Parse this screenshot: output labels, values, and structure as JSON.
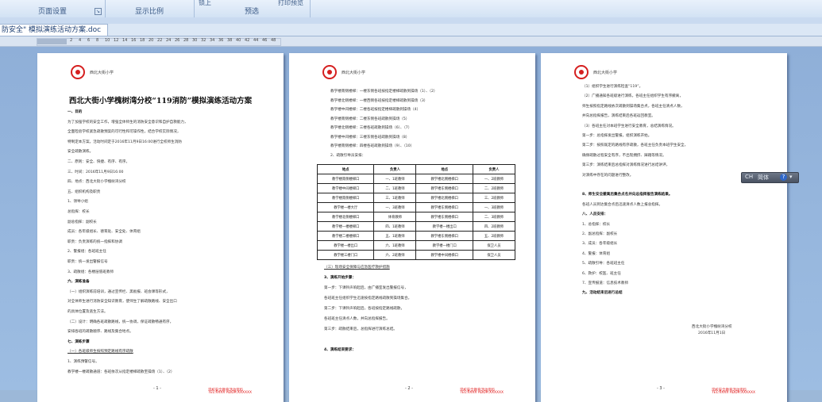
{
  "ribbon": {
    "groups": [
      "页面设置",
      "显示比例",
      "预选"
    ],
    "cut_labels": [
      "锁上",
      "打印预览"
    ]
  },
  "document_tab": {
    "title": "防安全\" 模拟演练活动方案.doc"
  },
  "ruler": {
    "ticks": [
      "2",
      "4",
      "6",
      "8",
      "10",
      "12",
      "14",
      "16",
      "18",
      "20",
      "22",
      "24",
      "26",
      "28",
      "30",
      "32",
      "34",
      "36",
      "38",
      "40",
      "42",
      "44",
      "46",
      "48"
    ]
  },
  "pages": [
    {
      "header": "西北大街小学",
      "title": "西北大街小学槐树湾分校“119消防”模拟演练活动方案",
      "lines": [
        {
          "t": "一、目的",
          "s": "b"
        },
        {
          "t": "为了加强学校的安全工作，增强全体师生的消防安全意识和自护自救能力，"
        },
        {
          "t": "全面检验学校紧急疏散预案的可行性和可操作性，结合学校实际情况，"
        },
        {
          "t": "特制定本方案。活动时间定于2016年11月9日16:00进行全校师生消防"
        },
        {
          "t": "安全疏散演练。"
        },
        {
          "t": "二、原则：安全、快捷、有序、有序。"
        },
        {
          "t": "三、时间：2016年11月9日16:00"
        },
        {
          "t": "四、地点：西北大街小学槐树湾分校"
        },
        {
          "t": "五、组织机构及职责"
        },
        {
          "t": "1、领导小组"
        },
        {
          "t": "总指挥：校长"
        },
        {
          "t": "副总指挥：副校长"
        },
        {
          "t": "成员：各年级组长、德育处、安全处、体育组"
        },
        {
          "t": "职责：负责演练的统一指挥和协调"
        },
        {
          "t": "2、警报组：各班班主任"
        },
        {
          "t": "职责：统一发出警报信号"
        },
        {
          "t": "3、疏散组：各楼层值班教师"
        },
        {
          "t": "六、演练准备",
          "s": "b"
        },
        {
          "t": "（一）组织演练前培训，通过宣传栏、黑板报、班会课等形式，"
        },
        {
          "t": "对全体师生进行消防安全知识教育，使师生了解疏散路线、安全出口"
        },
        {
          "t": "的具体位置及逃生方法。"
        },
        {
          "t": "（二）设计：明确各班疏散路线，统一协调，保证疏散畅通有序，"
        },
        {
          "t": "安排各班的疏散顺序、路线及集合地点。"
        },
        {
          "t": "七、演练步骤",
          "s": "b"
        },
        {
          "t": "（一）各班级师生按照预定路线有序疏散",
          "s": "u"
        },
        {
          "t": "1、演练预警信号。"
        },
        {
          "t": "教学楼一楼疏散通道：各班依次从指定楼梯疏散至操场（1）、（2）"
        }
      ],
      "page_num": "- 1 -",
      "red_footer": [
        "学校安全教育活动资料",
        "TEL:XXXX ADDR:XXXXXX"
      ]
    },
    {
      "header": "西北大街小学",
      "lines_top": [
        "教学楼南侧楼梯：一楼东侧各班按指定楼梯疏散到操场（1）、（2）",
        "教学楼北侧楼梯：一楼西侧各班按指定楼梯疏散到操场（3）",
        "教学楼中间楼梯：二楼各班按指定楼梯疏散到操场（4）",
        "教学楼南侧楼梯：二楼东侧各班疏散到操场（5）",
        "教学楼北侧楼梯：三楼各班疏散到操场（6）、（7）",
        "教学楼中间楼梯：三楼东侧各班疏散到操场（8）",
        "教学楼南侧楼梯：四楼各班疏散到操场（9）、（10）",
        "2、疏散引导员安排："
      ],
      "table": {
        "headers": [
          "地点",
          "负责人",
          "地点",
          "负责人"
        ],
        "rows": [
          [
            "教学楼南侧楼梯口",
            "一、1班教师",
            "教学楼北侧楼梯口",
            "一、2班教师"
          ],
          [
            "教学楼中间楼梯口",
            "二、1班教师",
            "教学楼东侧楼梯口",
            "二、2班教师"
          ],
          [
            "教学楼南侧楼梯口",
            "三、1班教师",
            "教学楼北侧楼梯口",
            "三、2班教师"
          ],
          [
            "教学楼一楼大厅",
            "一、3班教师",
            "教学楼东侧楼梯口",
            "一、3班教师"
          ],
          [
            "教学楼北侧楼梯口",
            "体育教师",
            "教学楼东侧楼梯口",
            "二、3班教师"
          ],
          [
            "教学楼一楼楼梯口",
            "四、1班教师",
            "教学楼一楼出口",
            "四、2班教师"
          ],
          [
            "教学楼二楼楼梯口",
            "五、1班教师",
            "教学楼东侧楼梯口",
            "五、2班教师"
          ],
          [
            "教学楼一楼出口",
            "六、1班教师",
            "教学楼一楼门口",
            "保卫人员"
          ],
          [
            "教学楼三楼门口",
            "六、2班教师",
            "教学楼中间楼梯口",
            "保卫人员"
          ]
        ]
      },
      "lines_bottom": [
        {
          "t": "（三）现场安全保障与应急医疗救护措施",
          "s": "u"
        },
        {
          "t": "3、演练开始步骤：",
          "s": "b"
        },
        {
          "t": "第一步：下课铃声响起后，由广播室发出警报信号，"
        },
        {
          "t": "各班班主任组织学生迅速按指定路线疏散到操场集合。"
        },
        {
          "t": "第二步：下课铃声响起后，各班按指定路线疏散，"
        },
        {
          "t": "各班班主任清点人数，并向总指挥报告。"
        },
        {
          "t": "第三步：疏散结束后，总指挥进行演练总结。"
        },
        {
          "t": ""
        },
        {
          "t": "4、演练结束要求：",
          "s": "b"
        }
      ],
      "page_num": "- 2 -",
      "red_footer": [
        "学校安全教育活动资料",
        "TEL:XXXX ADDR:XXXXXX"
      ]
    },
    {
      "header": "西北大街小学",
      "lines": [
        {
          "t": "（1）组织学生进行演练检查“119”。"
        },
        {
          "t": "（2）广播通知各班级进行演练，各班主任组织学生有序撤离，"
        },
        {
          "t": "师生按照指定路线依次疏散到操场集合点，各班主任清点人数，"
        },
        {
          "t": "并向总指挥报告，演练结束后各班返回教室。"
        },
        {
          "t": "（3）各班主任对本班学生进行安全教育，总结演练情况。"
        },
        {
          "t": "第一步：总指挥发出警报，组织演练开始。"
        },
        {
          "t": "第二步：按照既定的路线有序疏散，各班主任负责本班学生安全，"
        },
        {
          "t": "确保疏散过程安全有序，不出现拥挤、踩踏等情况。"
        },
        {
          "t": "第三步：演练结束后总指挥对演练情况进行总结讲评，"
        },
        {
          "t": "对演练中存在的问题进行整改。"
        },
        {
          "t": ""
        },
        {
          "t": "8、师生安全撤离后集合点名并向总指挥报告演练结果。",
          "s": "b"
        },
        {
          "t": "各班人员到达集合点后迅速清点人数上报总指挥。"
        },
        {
          "t": "八、人员安排：",
          "s": "b"
        },
        {
          "t": "1、总指挥：校长"
        },
        {
          "t": "2、副总指挥：副校长"
        },
        {
          "t": "3、成员：各年级组长"
        },
        {
          "t": "4、警报：体育组"
        },
        {
          "t": "5、疏散引导：各班班主任"
        },
        {
          "t": "6、救护：校医、班主任"
        },
        {
          "t": "7、宣传报道：信息技术教师"
        },
        {
          "t": "九、活动结束后进行总结",
          "s": "b"
        }
      ],
      "signature": "西北大街小学槐树湾分校",
      "date": "2016年11月1日",
      "page_num": "- 3 -",
      "red_footer": [
        "学校安全教育活动资料",
        "TEL:XXXX ADDR:XXXXXX"
      ]
    }
  ],
  "floating_toolbar": {
    "label_a": "CH",
    "label_b": "简体",
    "help": "?",
    "arrow": "▾"
  }
}
